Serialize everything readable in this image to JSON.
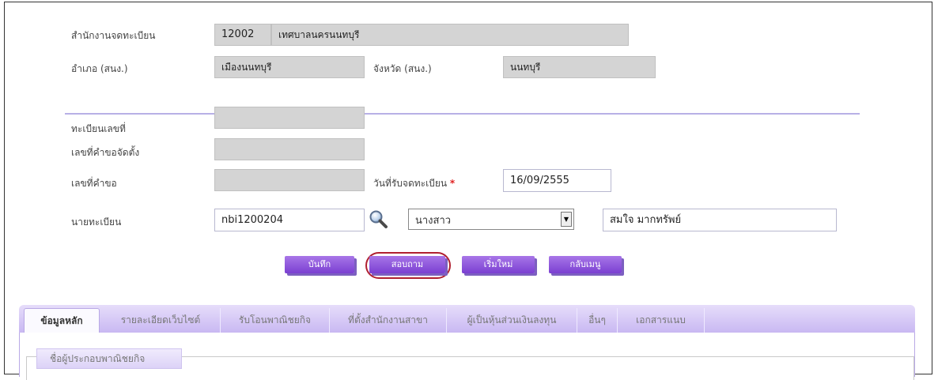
{
  "office": {
    "label": "สำนักงานจดทะเบียน",
    "code": "12002",
    "name": "เทศบาลนครนนทบุรี",
    "district_label": "อำเภอ (สนง.)",
    "district_value": "เมืองนนทบุรี",
    "province_label": "จังหวัด (สนง.)",
    "province_value": "นนทบุรี"
  },
  "form": {
    "registration_no_label": "ทะเบียนเลขที่",
    "registration_no_value": "",
    "setup_request_no_label": "เลขที่คำขอจัดตั้ง",
    "setup_request_no_value": "",
    "request_no_label": "เลขที่คำขอ",
    "request_no_value": "",
    "received_date_label": "วันที่รับจดทะเบียน",
    "required_mark": "*",
    "received_date_value": "16/09/2555",
    "registrar_label": "นายทะเบียน",
    "registrar_id": "nbi1200204",
    "title_select": "นางสาว",
    "registrar_name": "สมใจ มากทรัพย์"
  },
  "icons": {
    "search": "magnifier-icon",
    "dropdown": "dropdown-arrow-icon"
  },
  "buttons": {
    "save": "บันทึก",
    "inquire": "สอบถาม",
    "new": "เริ่มใหม่",
    "back_to_menu": "กลับเมนู"
  },
  "tabs": [
    {
      "label": "ข้อมูลหลัก",
      "active": true
    },
    {
      "label": "รายละเอียดเว็บไซต์",
      "active": false
    },
    {
      "label": "รับโอนพาณิชยกิจ",
      "active": false
    },
    {
      "label": "ที่ตั้งสำนักงานสาขา",
      "active": false
    },
    {
      "label": "ผู้เป็นหุ้นส่วนเงินลงทุน",
      "active": false
    },
    {
      "label": "อื่นๆ",
      "active": false
    },
    {
      "label": "เอกสารแนบ",
      "active": false
    }
  ],
  "section": {
    "legend": "ชื่อผู้ประกอบพาณิชยกิจ"
  },
  "colors": {
    "accent": "#8a4fdc",
    "divider": "#b8b0e6",
    "readonly_bg": "#d4d4d4",
    "highlight": "#b02030",
    "required": "#e02020"
  }
}
